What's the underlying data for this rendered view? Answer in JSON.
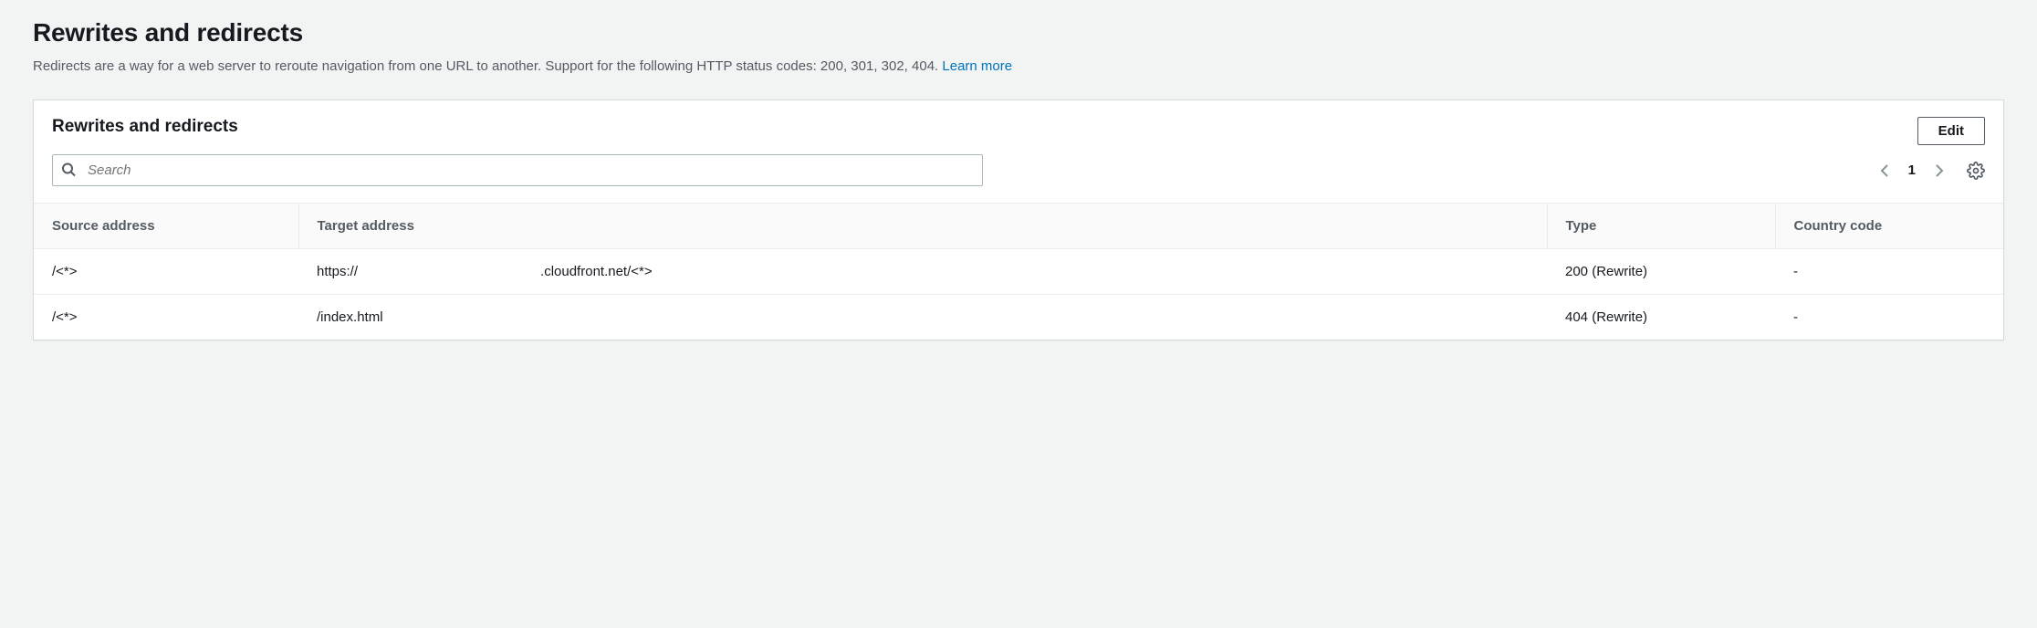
{
  "page": {
    "title": "Rewrites and redirects",
    "description": "Redirects are a way for a web server to reroute navigation from one URL to another. Support for the following HTTP status codes: 200, 301, 302, 404.",
    "learn_more": "Learn more"
  },
  "panel": {
    "title": "Rewrites and redirects",
    "edit_label": "Edit",
    "search_placeholder": "Search"
  },
  "pager": {
    "page": "1"
  },
  "table": {
    "headers": {
      "source": "Source address",
      "target": "Target address",
      "type": "Type",
      "country": "Country code"
    },
    "rows": [
      {
        "source": "/<*>",
        "target_prefix": "https://",
        "target_suffix": ".cloudfront.net/<*>",
        "type": "200 (Rewrite)",
        "country": "-"
      },
      {
        "source": "/<*>",
        "target_prefix": "/index.html",
        "target_suffix": "",
        "type": "404 (Rewrite)",
        "country": "-"
      }
    ]
  }
}
